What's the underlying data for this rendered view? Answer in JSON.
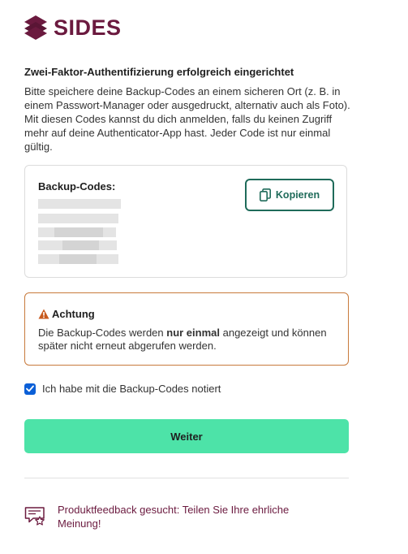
{
  "brand": {
    "name": "SIDES",
    "color": "#6b1a3f"
  },
  "page": {
    "heading": "Zwei-Faktor-Authentifizierung erfolgreich eingerichtet",
    "intro": "Bitte speichere deine Backup-Codes an einem sicheren Ort (z. B. in einem Passwort-Manager oder ausgedruckt, alternativ auch als Foto). Mit diesen Codes kannst du dich anmelden, falls du keinen Zugriff mehr auf deine Authenticator-App hast. Jeder Code ist nur einmal gültig."
  },
  "codes": {
    "title": "Backup-Codes:",
    "copy_label": "Kopieren",
    "copy_icon": "copy-icon",
    "redacted_count": 5
  },
  "warning": {
    "icon": "warning-triangle-icon",
    "title": "Achtung",
    "text_before": "Die Backup-Codes werden ",
    "text_bold": "nur einmal",
    "text_after": " angezeigt und können später nicht erneut abgerufen werden."
  },
  "confirm": {
    "label": "Ich habe mit die Backup-Codes notiert",
    "checked": true
  },
  "actions": {
    "next_label": "Weiter",
    "next_color": "#4de3a8"
  },
  "feedback": {
    "icon": "feedback-chat-icon",
    "text": "Produktfeedback gesucht: Teilen Sie Ihre ehrliche Meinung!"
  }
}
